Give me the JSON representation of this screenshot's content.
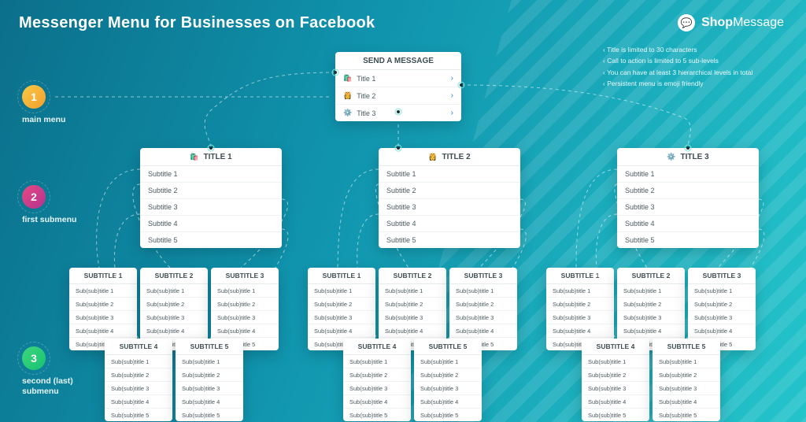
{
  "page_title": "Messenger Menu for Businesses on Facebook",
  "logo": {
    "brand_a": "Shop",
    "brand_b": "Message"
  },
  "notes": [
    "Title is limited to 30 characters",
    "Call to action is limited to 5 sub-levels",
    "You can have at least 3 hierarchical levels in total",
    "Persistent menu is emoji friendly"
  ],
  "levels": [
    {
      "num": "1",
      "label": "main menu",
      "color": "#f6c945"
    },
    {
      "num": "2",
      "label": "first submenu",
      "color": "#e64a81"
    },
    {
      "num": "3",
      "label": "second (last)\nsubmenu",
      "color": "#3fd67c"
    }
  ],
  "root": {
    "header": "SEND A MESSAGE",
    "items": [
      {
        "emoji": "🛍️",
        "label": "Title 1"
      },
      {
        "emoji": "👸",
        "label": "Title 2"
      },
      {
        "emoji": "⚙️",
        "label": "Title 3"
      }
    ]
  },
  "branches": [
    {
      "emoji": "🛍️",
      "title": "TITLE 1"
    },
    {
      "emoji": "👸",
      "title": "TITLE 2"
    },
    {
      "emoji": "⚙️",
      "title": "TITLE 3"
    }
  ],
  "subtitles": [
    "Subtitle 1",
    "Subtitle 2",
    "Subtitle 3",
    "Subtitle 4",
    "Subtitle 5"
  ],
  "leaf_headers": [
    "SUBTITLE 1",
    "SUBTITLE 2",
    "SUBTITLE 3",
    "SUBTITLE 4",
    "SUBTITLE 5"
  ],
  "leaf_rows": [
    "Sub(sub)title 1",
    "Sub(sub)title 2",
    "Sub(sub)title 3",
    "Sub(sub)title 4",
    "Sub(sub)title 5"
  ]
}
